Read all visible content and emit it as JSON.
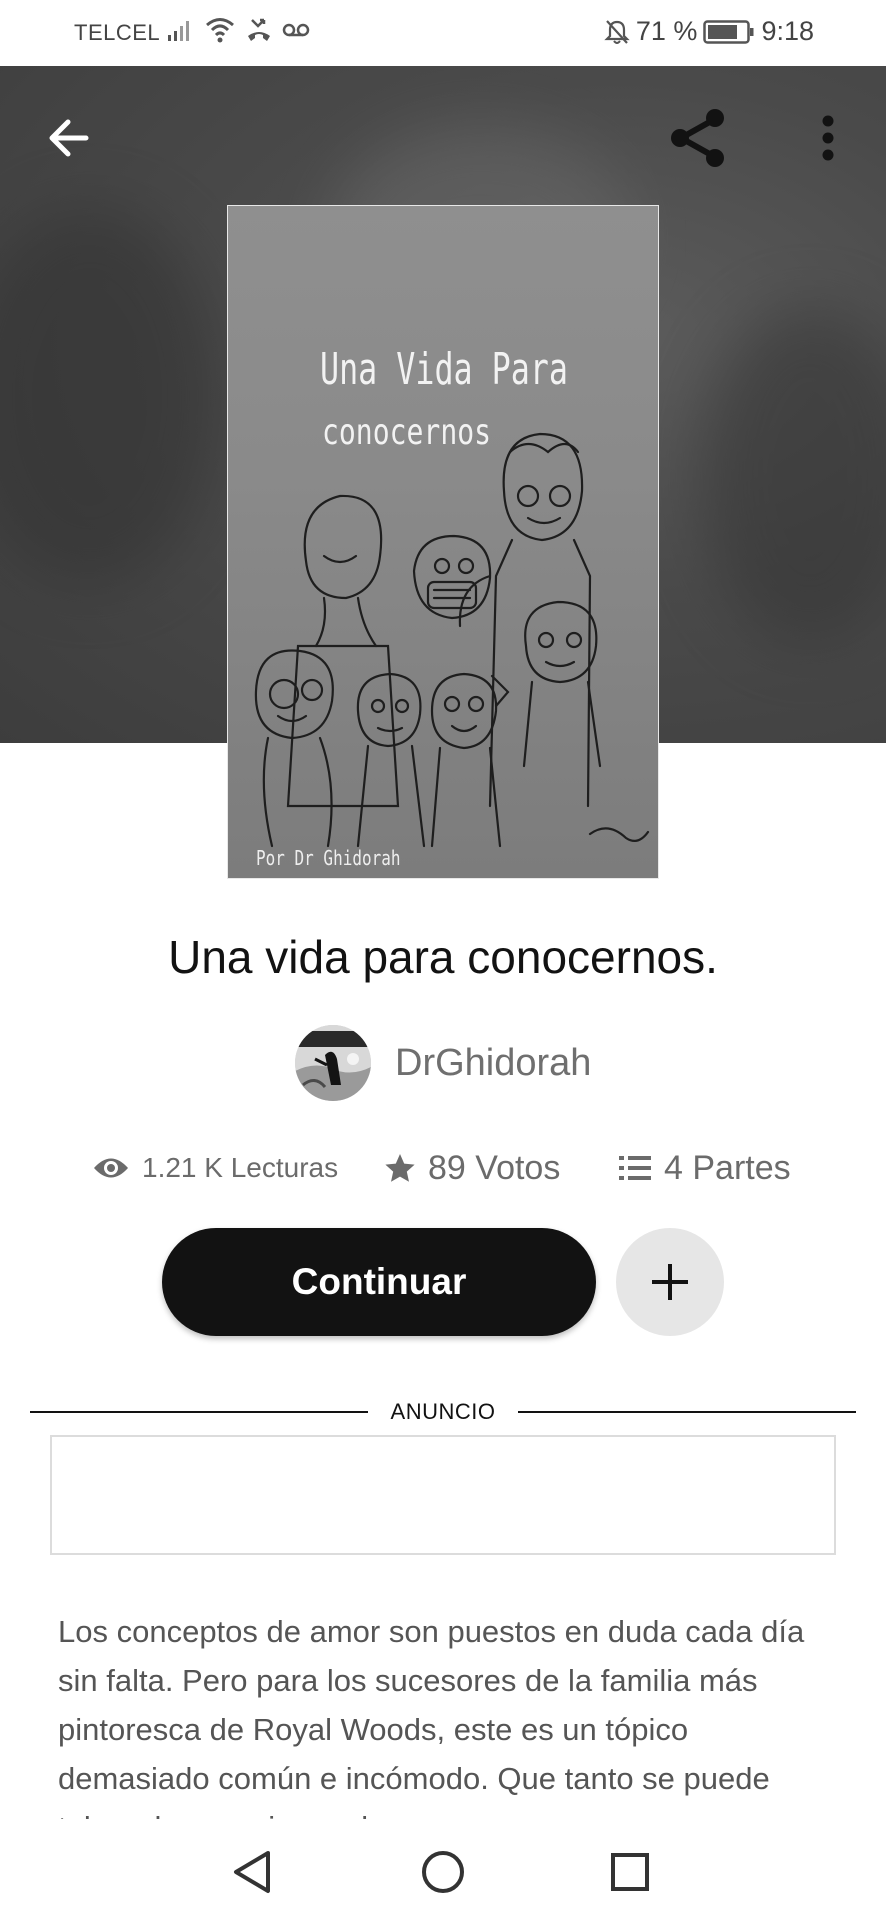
{
  "status_bar": {
    "carrier": "TELCEL",
    "battery": "71 %",
    "time": "9:18"
  },
  "story": {
    "cover_title_line1": "Una Vida Para",
    "cover_title_line2": "conocernos",
    "cover_author": "Por Dr Ghidorah",
    "title": "Una vida para conocernos.",
    "author": "DrGhidorah",
    "reads": "1.21 K Lecturas",
    "votes": "89 Votos",
    "parts": "4 Partes"
  },
  "actions": {
    "continue_label": "Continuar"
  },
  "ad": {
    "label": "ANUNCIO"
  },
  "description": "Los conceptos de amor son puestos en duda cada día sin falta. Pero para los sucesores de la familia más pintoresca de Royal Woods, este es un tópico demasiado común e incómodo. Que tanto se puede tolerar las ocasiones de",
  "icons": {
    "back": "arrow-left-icon",
    "share": "share-icon",
    "more": "more-vertical-icon",
    "reads": "eye-icon",
    "votes": "star-icon",
    "parts": "list-icon",
    "add": "plus-icon"
  },
  "colors": {
    "hero_bg": "#4a4a4a",
    "primary_button": "#121212",
    "secondary_button": "#e6e6e6",
    "text_muted": "#6b6b6b"
  }
}
